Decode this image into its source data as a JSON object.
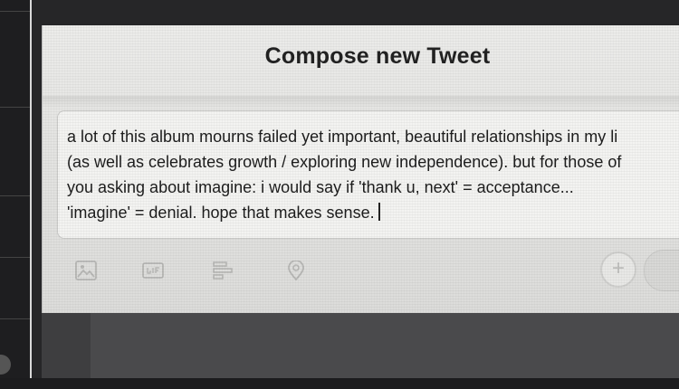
{
  "compose": {
    "title": "Compose new Tweet",
    "tweet_lines": [
      "a lot of this album mourns failed yet important, beautiful relationships in my li",
      "(as well as celebrates growth / exploring new independence). but for those of",
      "you asking about imagine: i would say if 'thank u, next' = acceptance...",
      "'imagine' = denial. hope that makes sense."
    ]
  },
  "toolbar": {
    "icons": [
      "image-icon",
      "gif-icon",
      "poll-icon",
      "location-icon"
    ],
    "add_label": "+"
  },
  "colors": {
    "screen_background": "#e6e6e4",
    "text": "#1d1d1d",
    "icon_muted": "#b7b7b5"
  }
}
